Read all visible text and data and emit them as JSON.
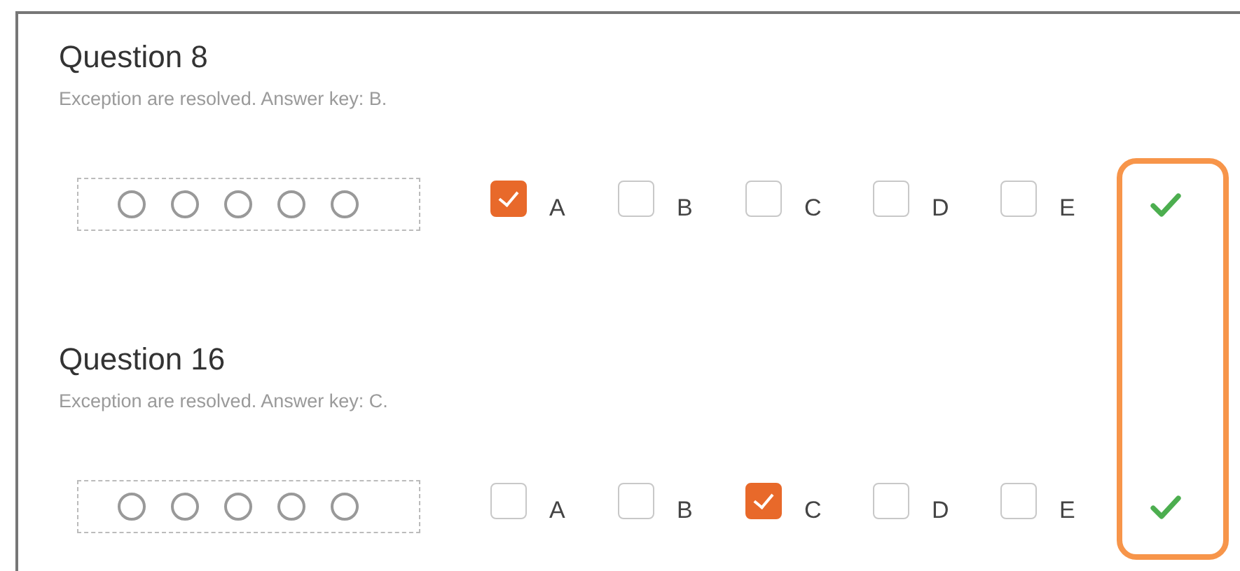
{
  "questions": [
    {
      "title": "Question 8",
      "note": "Exception are resolved. Answer key: B.",
      "correct": true,
      "options": [
        {
          "label": "A",
          "checked": true
        },
        {
          "label": "B",
          "checked": false
        },
        {
          "label": "C",
          "checked": false
        },
        {
          "label": "D",
          "checked": false
        },
        {
          "label": "E",
          "checked": false
        }
      ]
    },
    {
      "title": "Question 16",
      "note": "Exception are resolved. Answer key: C.",
      "correct": true,
      "options": [
        {
          "label": "A",
          "checked": false
        },
        {
          "label": "B",
          "checked": false
        },
        {
          "label": "C",
          "checked": true
        },
        {
          "label": "D",
          "checked": false
        },
        {
          "label": "E",
          "checked": false
        }
      ]
    }
  ]
}
